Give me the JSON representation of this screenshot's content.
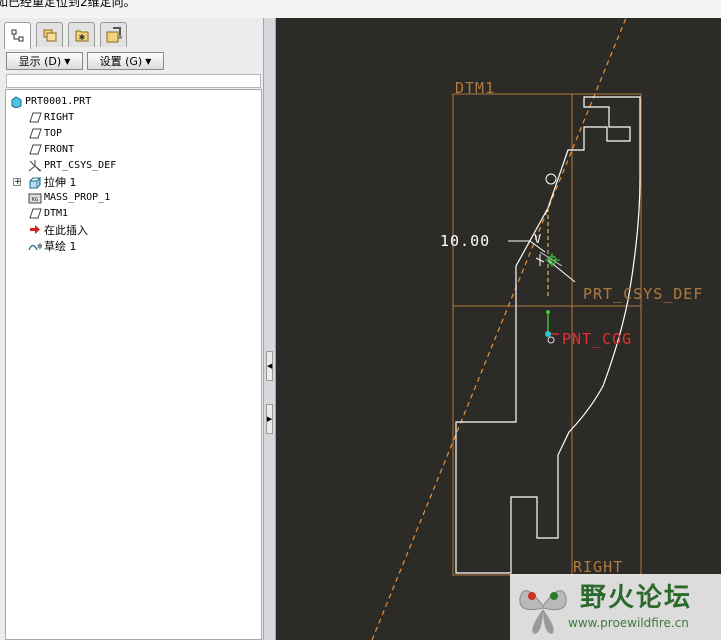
{
  "message_bar": {
    "text": "如已经重定位到2维定向。"
  },
  "navigator": {
    "tabs": [
      {
        "icon": "model-tree-icon",
        "active": true
      },
      {
        "icon": "folder-browser-icon",
        "active": false
      },
      {
        "icon": "favorites-icon",
        "active": false
      },
      {
        "icon": "connections-icon",
        "active": false
      }
    ],
    "show_button": "显示 (D)",
    "settings_button": "设置 (G)"
  },
  "model_tree": {
    "items": [
      {
        "label": "PRT0001.PRT",
        "icon": "part-icon"
      },
      {
        "label": "RIGHT",
        "icon": "datum-plane-icon"
      },
      {
        "label": "TOP",
        "icon": "datum-plane-icon"
      },
      {
        "label": "FRONT",
        "icon": "datum-plane-icon"
      },
      {
        "label": "PRT_CSYS_DEF",
        "icon": "coordinate-system-icon"
      },
      {
        "label": "拉伸 1",
        "icon": "extrude-icon"
      },
      {
        "label": "MASS_PROP_1",
        "icon": "analysis-icon"
      },
      {
        "label": "DTM1",
        "icon": "datum-plane-icon"
      },
      {
        "label": "在此插入",
        "icon": "insert-here-arrow-icon"
      },
      {
        "label": "草绘 1",
        "icon": "sketch-icon"
      }
    ]
  },
  "graphics": {
    "labels": {
      "dtm1": "DTM1",
      "dimension": "10.00",
      "dimension_symbol": "V",
      "csys": "PRT_CSYS_DEF",
      "cog": "PNT_COG",
      "right": "RIGHT"
    },
    "colors": {
      "background": "#2d2b27",
      "datum": "#b07a3c",
      "datum_line": "#e8923a",
      "geometry": "#ffffff",
      "dimension": "#ffffff",
      "csys_green": "#3cc83c",
      "cog_cyan": "#28c8d8",
      "cog_red": "#e03030"
    }
  },
  "watermark": {
    "title": "野火论坛",
    "url": "www.proewildfire.cn"
  }
}
